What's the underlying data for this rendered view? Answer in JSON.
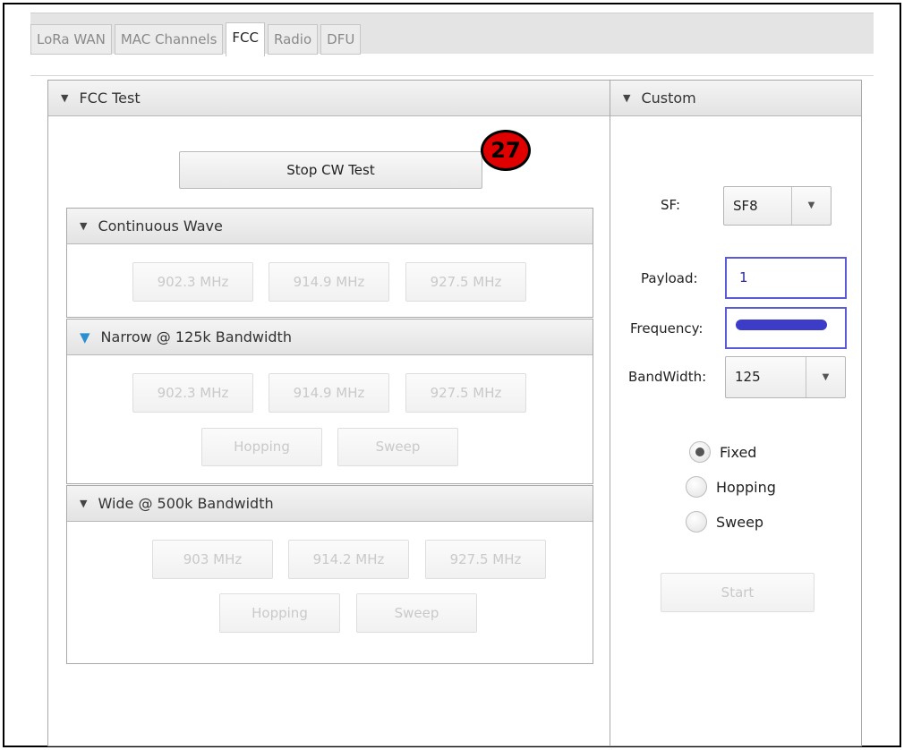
{
  "tabs": [
    {
      "label": "LoRa WAN",
      "active": false
    },
    {
      "label": "MAC Channels",
      "active": false
    },
    {
      "label": "FCC",
      "active": true
    },
    {
      "label": "Radio",
      "active": false
    },
    {
      "label": "DFU",
      "active": false
    }
  ],
  "fcc_panel": {
    "title": "FCC Test",
    "stop_button": "Stop CW Test",
    "badge": "27",
    "continuous_wave": {
      "title": "Continuous Wave",
      "buttons": [
        "902.3 MHz",
        "914.9 MHz",
        "927.5 MHz"
      ]
    },
    "narrow": {
      "title": "Narrow @ 125k Bandwidth",
      "buttons": [
        "902.3 MHz",
        "914.9 MHz",
        "927.5 MHz"
      ],
      "hopping": "Hopping",
      "sweep": "Sweep"
    },
    "wide": {
      "title": "Wide @ 500k Bandwidth",
      "buttons": [
        "903 MHz",
        "914.2 MHz",
        "927.5 MHz"
      ],
      "hopping": "Hopping",
      "sweep": "Sweep"
    }
  },
  "custom_panel": {
    "title": "Custom",
    "sf_label": "SF:",
    "sf_value": "SF8",
    "payload_label": "Payload:",
    "payload_value": "1",
    "frequency_label": "Frequency:",
    "bandwidth_label": "BandWidth:",
    "bandwidth_value": "125",
    "radios": [
      {
        "label": "Fixed",
        "checked": true
      },
      {
        "label": "Hopping",
        "checked": false
      },
      {
        "label": "Sweep",
        "checked": false
      }
    ],
    "start_button": "Start"
  },
  "colors": {
    "badge": "#e00000",
    "field_border": "#5a5ad8",
    "redaction": "#3c3cc8"
  },
  "icons": {
    "collapse": "triangle-down-icon",
    "combo": "chevron-down-icon"
  }
}
